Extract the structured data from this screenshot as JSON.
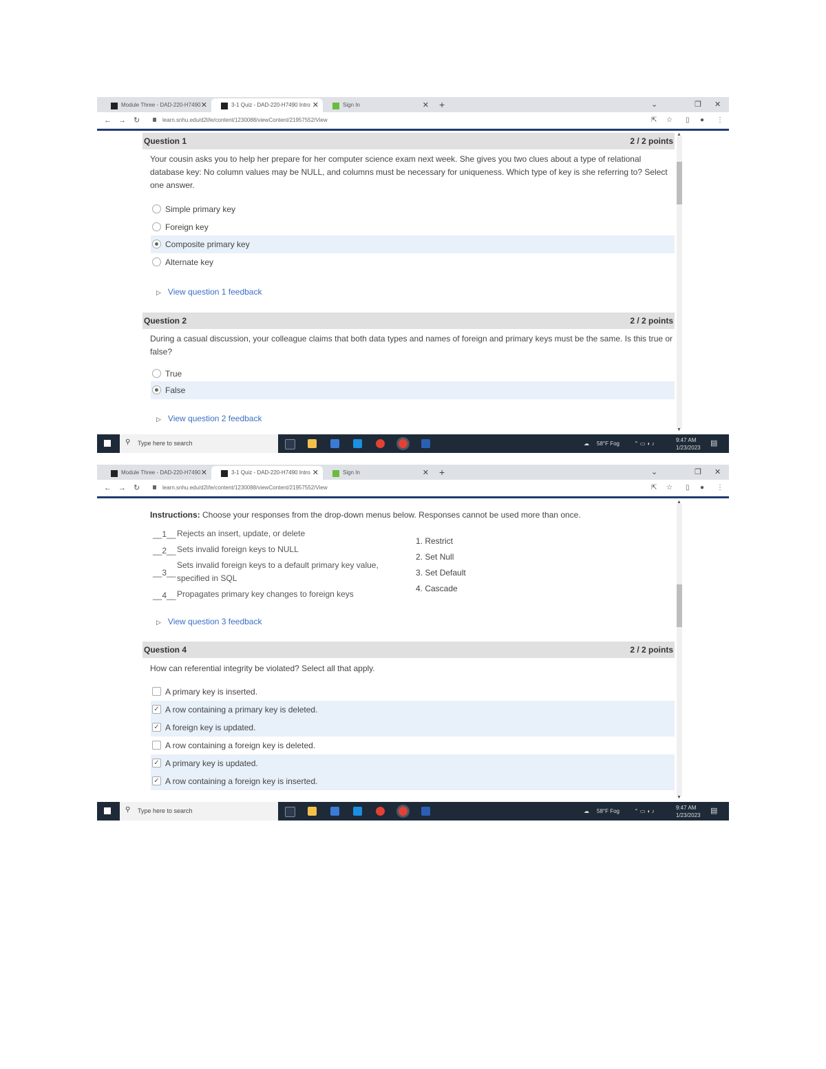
{
  "browser": {
    "tabs": [
      {
        "title": "Module Three - DAD-220-H7490"
      },
      {
        "title": "3-1 Quiz - DAD-220-H7490 Intro"
      },
      {
        "title": "Sign In"
      }
    ],
    "url": "learn.snhu.edu/d2l/le/content/1230088/viewContent/21957552/View"
  },
  "taskbar": {
    "search_placeholder": "Type here to search",
    "weather": "58°F Fog",
    "time": "9:47 AM",
    "date": "1/23/2023"
  },
  "questions": {
    "q1": {
      "label": "Question 1",
      "points": "2 / 2 points",
      "text": "Your cousin asks you to help her prepare for her computer science exam next week. She gives you two clues about a type of relational database key: No column values may be NULL, and columns must be necessary for uniqueness. Which type of key is she referring to? Select one answer.",
      "options": [
        "Simple primary key",
        "Foreign key",
        "Composite primary key",
        "Alternate key"
      ],
      "feedback": "View question 1 feedback"
    },
    "q2": {
      "label": "Question 2",
      "points": "2 / 2 points",
      "text": "During a casual discussion, your colleague claims that both data types and names of foreign and primary keys must be the same. Is this true or false?",
      "options": [
        "True",
        "False"
      ],
      "feedback": "View question 2 feedback"
    },
    "q3": {
      "instructions_label": "Instructions:",
      "instructions": "Choose your responses from the drop-down menus below. Responses cannot be used more than once.",
      "items": [
        {
          "blank": "__1__",
          "text": "Rejects an insert, update, or delete"
        },
        {
          "blank": "__2__",
          "text": "Sets invalid foreign keys to NULL"
        },
        {
          "blank": "__3__",
          "text": "Sets invalid foreign keys to a default primary key value, specified in SQL"
        },
        {
          "blank": "__4__",
          "text": "Propagates primary key changes to foreign keys"
        }
      ],
      "answers": [
        "1. Restrict",
        "2. Set Null",
        "3. Set Default",
        "4. Cascade"
      ],
      "feedback": "View question 3 feedback"
    },
    "q4": {
      "label": "Question 4",
      "points": "2 / 2 points",
      "text": "How can referential integrity be violated? Select all that apply.",
      "options": [
        "A primary key is inserted.",
        "A row containing a primary key is deleted.",
        "A foreign key is updated.",
        "A row containing a foreign key is deleted.",
        "A primary key is updated.",
        "A row containing a foreign key is inserted."
      ]
    }
  }
}
